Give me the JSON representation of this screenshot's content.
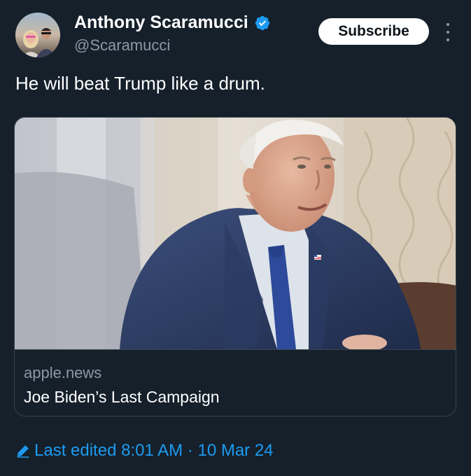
{
  "author": {
    "display_name": "Anthony Scaramucci",
    "handle": "@Scaramucci",
    "verified_icon": "verified-badge-icon",
    "avatar_icon": "profile-avatar"
  },
  "actions": {
    "subscribe_label": "Subscribe",
    "more_icon": "more-options-icon"
  },
  "tweet": {
    "text": "He will beat Trump like a drum."
  },
  "link_card": {
    "domain": "apple.news",
    "title": "Joe Biden’s Last Campaign",
    "image_icon": "article-photo"
  },
  "edit_info": {
    "icon": "pencil-icon",
    "text": "Last edited 8:01 AM · 10 Mar 24"
  },
  "colors": {
    "background": "#15202b",
    "accent": "#1d9bf0",
    "secondary_text": "#8b98a5",
    "border": "#38444d"
  }
}
